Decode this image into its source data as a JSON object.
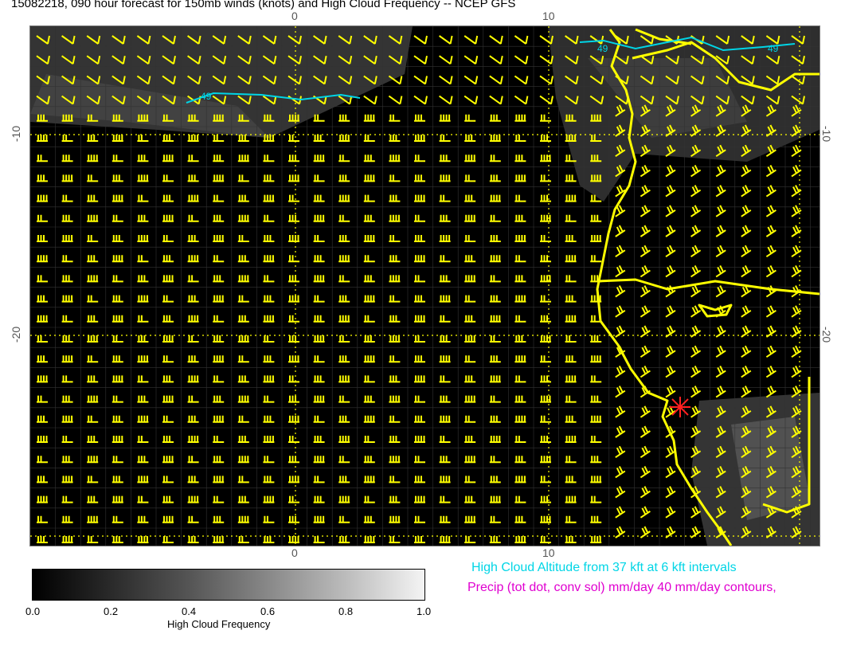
{
  "title": "15082218, 090 hour forecast for 150mb winds (knots) and High Cloud Frequency -- NCEP GFS",
  "longitude_ticks_top": [
    "0",
    "10"
  ],
  "longitude_ticks_bottom": [
    "0",
    "10"
  ],
  "latitude_ticks_left": [
    "-10",
    "-20"
  ],
  "latitude_ticks_right": [
    "-10",
    "-20"
  ],
  "contour_labels": [
    "49",
    "49",
    "49"
  ],
  "colorbar": {
    "label": "High Cloud Frequency",
    "ticks": [
      "0.0",
      "0.2",
      "0.4",
      "0.6",
      "0.8",
      "1.0"
    ]
  },
  "legend": {
    "cloud_altitude": "High Cloud Altitude from 37 kft at 6 kft intervals",
    "precip": "Precip (tot dot, conv sol) mm/day 40 mm/day contours,"
  },
  "colors": {
    "background": "#000000",
    "wind_barbs": "#ffff00",
    "coastline": "#ffff00",
    "gridlines": "#ffff00",
    "cloud_altitude_contour": "#00d5e6",
    "precip_text": "#e000d0",
    "marker": "#ff2020"
  },
  "marker": "red-asterisk-station"
}
